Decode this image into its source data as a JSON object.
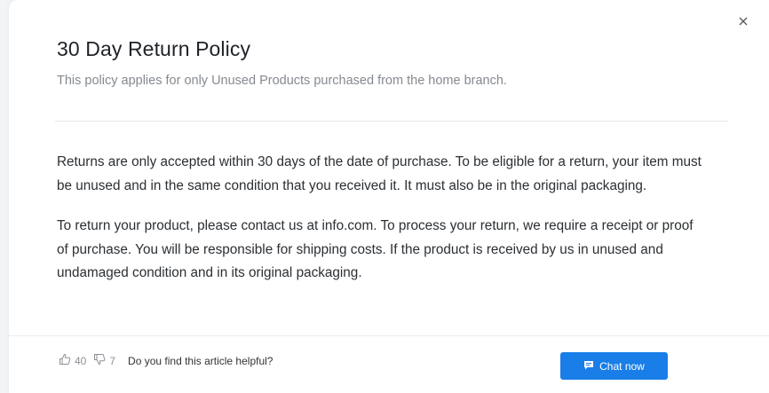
{
  "modal": {
    "title": "30 Day Return Policy",
    "subtitle": "This policy applies for only Unused Products purchased from the home branch.",
    "paragraphs": [
      "Returns are only accepted within 30 days of the date of purchase. To be eligible for a return, your item must be unused and in the same condition that you received it. It must also be in the original packaging.",
      "To return your product, please contact us at info.com. To process your return, we require a receipt or proof of purchase. You will be responsible for shipping costs. If the product is received by us in unused and undamaged condition and in its original packaging."
    ],
    "close_icon": "close-icon"
  },
  "footer": {
    "likes": "40",
    "dislikes": "7",
    "question": "Do you find this article helpful?",
    "chat_label": "Chat now",
    "like_icon": "thumbs-up-icon",
    "dislike_icon": "thumbs-down-icon",
    "chat_icon": "chat-bubble-icon"
  },
  "colors": {
    "accent": "#1a7ee8",
    "title": "#1f2328",
    "subtitle": "#858a90"
  }
}
